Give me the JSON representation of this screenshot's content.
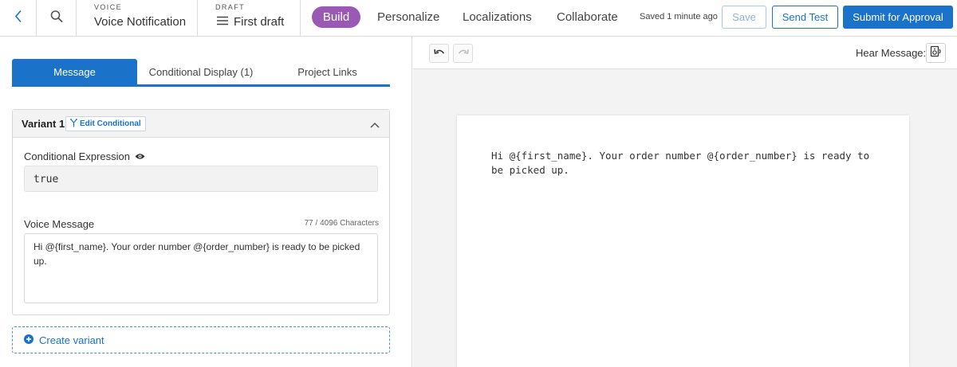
{
  "header": {
    "channel_caption": "VOICE",
    "channel_title": "Voice Notification",
    "draft_caption": "DRAFT",
    "draft_title": "First draft",
    "nav": {
      "build": "Build",
      "personalize": "Personalize",
      "localizations": "Localizations",
      "collaborate": "Collaborate"
    },
    "saved_status": "Saved 1 minute ago",
    "save_label": "Save",
    "send_test_label": "Send Test",
    "submit_label": "Submit for Approval"
  },
  "tabs": {
    "message": "Message",
    "conditional_display": "Conditional Display (1)",
    "project_links": "Project Links"
  },
  "variant": {
    "title": "Variant 1",
    "edit_conditional": "Edit Conditional",
    "conditional_expression_label": "Conditional Expression",
    "conditional_expression_value": "true",
    "voice_message_label": "Voice Message",
    "char_count": "77 / 4096 Characters",
    "voice_message_value": "Hi @{first_name}. Your order number @{order_number} is ready to be picked up."
  },
  "create_variant_label": "Create variant",
  "preview": {
    "hear_message_label": "Hear Message:",
    "text": "Hi @{first_name}. Your order number @{order_number} is ready to be picked up."
  },
  "colors": {
    "primary": "#1a73c9",
    "build_pill": "#9b59b6",
    "preview_bg": "#f3f3f3"
  },
  "icons": {
    "back": "chevron-left-icon",
    "search": "search-icon",
    "menu": "hamburger-menu-icon",
    "edit_conditional": "conditional-branch-icon",
    "collapse": "chevron-up-icon",
    "visibility": "eye-icon",
    "create": "plus-circle-icon",
    "undo": "undo-icon",
    "redo": "redo-icon",
    "hear": "speaker-icon"
  }
}
